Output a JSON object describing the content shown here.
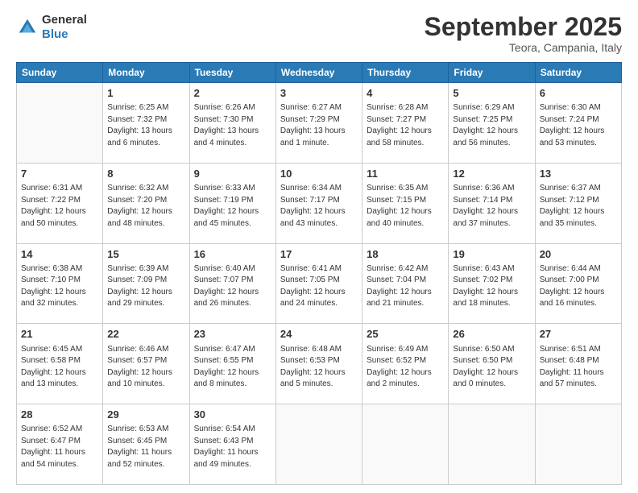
{
  "header": {
    "logo": {
      "general": "General",
      "blue": "Blue"
    },
    "title": "September 2025",
    "subtitle": "Teora, Campania, Italy"
  },
  "calendar": {
    "days_of_week": [
      "Sunday",
      "Monday",
      "Tuesday",
      "Wednesday",
      "Thursday",
      "Friday",
      "Saturday"
    ],
    "weeks": [
      [
        {
          "day": "",
          "sunrise": "",
          "sunset": "",
          "daylight": ""
        },
        {
          "day": "1",
          "sunrise": "Sunrise: 6:25 AM",
          "sunset": "Sunset: 7:32 PM",
          "daylight": "Daylight: 13 hours and 6 minutes."
        },
        {
          "day": "2",
          "sunrise": "Sunrise: 6:26 AM",
          "sunset": "Sunset: 7:30 PM",
          "daylight": "Daylight: 13 hours and 4 minutes."
        },
        {
          "day": "3",
          "sunrise": "Sunrise: 6:27 AM",
          "sunset": "Sunset: 7:29 PM",
          "daylight": "Daylight: 13 hours and 1 minute."
        },
        {
          "day": "4",
          "sunrise": "Sunrise: 6:28 AM",
          "sunset": "Sunset: 7:27 PM",
          "daylight": "Daylight: 12 hours and 58 minutes."
        },
        {
          "day": "5",
          "sunrise": "Sunrise: 6:29 AM",
          "sunset": "Sunset: 7:25 PM",
          "daylight": "Daylight: 12 hours and 56 minutes."
        },
        {
          "day": "6",
          "sunrise": "Sunrise: 6:30 AM",
          "sunset": "Sunset: 7:24 PM",
          "daylight": "Daylight: 12 hours and 53 minutes."
        }
      ],
      [
        {
          "day": "7",
          "sunrise": "Sunrise: 6:31 AM",
          "sunset": "Sunset: 7:22 PM",
          "daylight": "Daylight: 12 hours and 50 minutes."
        },
        {
          "day": "8",
          "sunrise": "Sunrise: 6:32 AM",
          "sunset": "Sunset: 7:20 PM",
          "daylight": "Daylight: 12 hours and 48 minutes."
        },
        {
          "day": "9",
          "sunrise": "Sunrise: 6:33 AM",
          "sunset": "Sunset: 7:19 PM",
          "daylight": "Daylight: 12 hours and 45 minutes."
        },
        {
          "day": "10",
          "sunrise": "Sunrise: 6:34 AM",
          "sunset": "Sunset: 7:17 PM",
          "daylight": "Daylight: 12 hours and 43 minutes."
        },
        {
          "day": "11",
          "sunrise": "Sunrise: 6:35 AM",
          "sunset": "Sunset: 7:15 PM",
          "daylight": "Daylight: 12 hours and 40 minutes."
        },
        {
          "day": "12",
          "sunrise": "Sunrise: 6:36 AM",
          "sunset": "Sunset: 7:14 PM",
          "daylight": "Daylight: 12 hours and 37 minutes."
        },
        {
          "day": "13",
          "sunrise": "Sunrise: 6:37 AM",
          "sunset": "Sunset: 7:12 PM",
          "daylight": "Daylight: 12 hours and 35 minutes."
        }
      ],
      [
        {
          "day": "14",
          "sunrise": "Sunrise: 6:38 AM",
          "sunset": "Sunset: 7:10 PM",
          "daylight": "Daylight: 12 hours and 32 minutes."
        },
        {
          "day": "15",
          "sunrise": "Sunrise: 6:39 AM",
          "sunset": "Sunset: 7:09 PM",
          "daylight": "Daylight: 12 hours and 29 minutes."
        },
        {
          "day": "16",
          "sunrise": "Sunrise: 6:40 AM",
          "sunset": "Sunset: 7:07 PM",
          "daylight": "Daylight: 12 hours and 26 minutes."
        },
        {
          "day": "17",
          "sunrise": "Sunrise: 6:41 AM",
          "sunset": "Sunset: 7:05 PM",
          "daylight": "Daylight: 12 hours and 24 minutes."
        },
        {
          "day": "18",
          "sunrise": "Sunrise: 6:42 AM",
          "sunset": "Sunset: 7:04 PM",
          "daylight": "Daylight: 12 hours and 21 minutes."
        },
        {
          "day": "19",
          "sunrise": "Sunrise: 6:43 AM",
          "sunset": "Sunset: 7:02 PM",
          "daylight": "Daylight: 12 hours and 18 minutes."
        },
        {
          "day": "20",
          "sunrise": "Sunrise: 6:44 AM",
          "sunset": "Sunset: 7:00 PM",
          "daylight": "Daylight: 12 hours and 16 minutes."
        }
      ],
      [
        {
          "day": "21",
          "sunrise": "Sunrise: 6:45 AM",
          "sunset": "Sunset: 6:58 PM",
          "daylight": "Daylight: 12 hours and 13 minutes."
        },
        {
          "day": "22",
          "sunrise": "Sunrise: 6:46 AM",
          "sunset": "Sunset: 6:57 PM",
          "daylight": "Daylight: 12 hours and 10 minutes."
        },
        {
          "day": "23",
          "sunrise": "Sunrise: 6:47 AM",
          "sunset": "Sunset: 6:55 PM",
          "daylight": "Daylight: 12 hours and 8 minutes."
        },
        {
          "day": "24",
          "sunrise": "Sunrise: 6:48 AM",
          "sunset": "Sunset: 6:53 PM",
          "daylight": "Daylight: 12 hours and 5 minutes."
        },
        {
          "day": "25",
          "sunrise": "Sunrise: 6:49 AM",
          "sunset": "Sunset: 6:52 PM",
          "daylight": "Daylight: 12 hours and 2 minutes."
        },
        {
          "day": "26",
          "sunrise": "Sunrise: 6:50 AM",
          "sunset": "Sunset: 6:50 PM",
          "daylight": "Daylight: 12 hours and 0 minutes."
        },
        {
          "day": "27",
          "sunrise": "Sunrise: 6:51 AM",
          "sunset": "Sunset: 6:48 PM",
          "daylight": "Daylight: 11 hours and 57 minutes."
        }
      ],
      [
        {
          "day": "28",
          "sunrise": "Sunrise: 6:52 AM",
          "sunset": "Sunset: 6:47 PM",
          "daylight": "Daylight: 11 hours and 54 minutes."
        },
        {
          "day": "29",
          "sunrise": "Sunrise: 6:53 AM",
          "sunset": "Sunset: 6:45 PM",
          "daylight": "Daylight: 11 hours and 52 minutes."
        },
        {
          "day": "30",
          "sunrise": "Sunrise: 6:54 AM",
          "sunset": "Sunset: 6:43 PM",
          "daylight": "Daylight: 11 hours and 49 minutes."
        },
        {
          "day": "",
          "sunrise": "",
          "sunset": "",
          "daylight": ""
        },
        {
          "day": "",
          "sunrise": "",
          "sunset": "",
          "daylight": ""
        },
        {
          "day": "",
          "sunrise": "",
          "sunset": "",
          "daylight": ""
        },
        {
          "day": "",
          "sunrise": "",
          "sunset": "",
          "daylight": ""
        }
      ]
    ]
  }
}
